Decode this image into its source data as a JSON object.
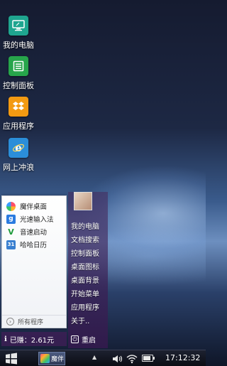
{
  "desktop_icons": [
    {
      "label": "我的电脑",
      "icon": "computer-icon",
      "color": "#1fa58f"
    },
    {
      "label": "控制面板",
      "icon": "control-panel-icon",
      "color": "#27a54b"
    },
    {
      "label": "应用程序",
      "icon": "dropbox-icon",
      "color": "#f39a12"
    },
    {
      "label": "网上冲浪",
      "icon": "ie-browser-icon",
      "color": "#2b8ed9"
    }
  ],
  "start_menu": {
    "items": [
      {
        "label": "魔伴桌面",
        "icon": "pinwheel-icon"
      },
      {
        "label": "光速输入法",
        "icon": "keyboard-g-icon"
      },
      {
        "label": "音速启动",
        "icon": "v-launch-icon"
      },
      {
        "label": "哈哈日历",
        "icon": "calendar-icon"
      }
    ],
    "all_programs": "所有程序",
    "right_links": [
      "我的电脑",
      "文档搜索",
      "控制面板",
      "桌面图标",
      "桌面背景",
      "开始菜单",
      "应用程序",
      "关于.."
    ],
    "earnings": "已赚：2.61元",
    "restart": "重启"
  },
  "taskbar": {
    "app_label": "魔伴",
    "clock": "17:12:32",
    "battery_level": 0.8
  }
}
